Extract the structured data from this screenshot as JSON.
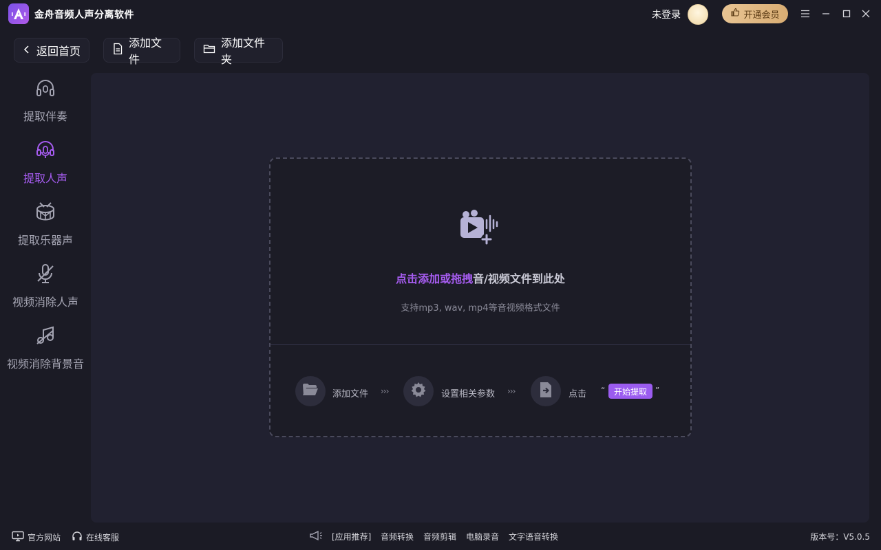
{
  "app": {
    "title": "金舟音频人声分离软件",
    "logo_text": "A"
  },
  "titlebar": {
    "login_text": "未登录",
    "vip_label": "开通会员",
    "menu_icon": "menu-icon",
    "minimize_icon": "minimize-icon",
    "maximize_icon": "maximize-icon",
    "close_icon": "close-icon"
  },
  "toolbar": {
    "back_label": "返回首页",
    "add_file_label": "添加文件",
    "add_folder_label": "添加文件夹"
  },
  "sidebar": {
    "items": [
      {
        "label": "提取伴奏",
        "icon": "headphones-icon",
        "active": false
      },
      {
        "label": "提取人声",
        "icon": "headset-mic-icon",
        "active": true
      },
      {
        "label": "提取乐器声",
        "icon": "drum-icon",
        "active": false
      },
      {
        "label": "视频消除人声",
        "icon": "mic-off-icon",
        "active": false
      },
      {
        "label": "视频消除背景音",
        "icon": "music-off-icon",
        "active": false
      }
    ]
  },
  "dropzone": {
    "main_highlight": "点击添加或拖拽",
    "main_rest": "音/视频文件到此处",
    "sub": "支持mp3, wav, mp4等音视频格式文件",
    "steps": [
      {
        "label": "添加文件",
        "icon": "folder-open-icon"
      },
      {
        "label": "设置相关参数",
        "icon": "gear-icon"
      },
      {
        "label": "点击",
        "icon": "file-export-icon"
      }
    ],
    "arrows": "›››",
    "start_badge": "开始提取",
    "quote_open": "“",
    "quote_close": "”"
  },
  "footer": {
    "official_site": "官方网站",
    "online_service": "在线客服",
    "recommend_label": "[应用推荐]",
    "links": [
      "音频转换",
      "音频剪辑",
      "电脑录音",
      "文字语音转换"
    ],
    "version": "版本号：V5.0.5"
  },
  "colors": {
    "accent": "#a65cf0",
    "background": "#1b1b25",
    "panel": "#212130",
    "vip_gold": "#e8c493"
  }
}
